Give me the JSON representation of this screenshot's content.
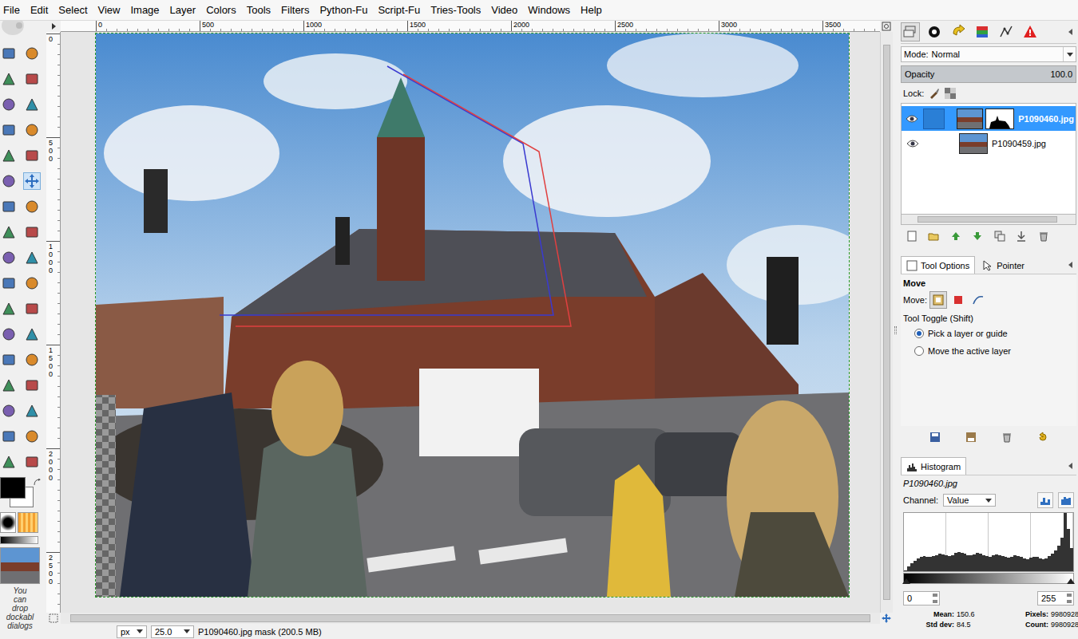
{
  "window": {
    "title": "GIMP"
  },
  "menu": [
    "File",
    "Edit",
    "Select",
    "View",
    "Image",
    "Layer",
    "Colors",
    "Tools",
    "Filters",
    "Python-Fu",
    "Script-Fu",
    "Tries-Tools",
    "Video",
    "Windows",
    "Help"
  ],
  "toolbox": {
    "tools": [
      {
        "selected": false
      },
      {
        "selected": false
      },
      {
        "selected": false
      },
      {
        "selected": false
      },
      {
        "selected": false
      },
      {
        "selected": false
      },
      {
        "selected": false
      },
      {
        "selected": false
      },
      {
        "selected": false
      },
      {
        "selected": false
      },
      {
        "selected": false
      },
      {
        "selected": true
      },
      {
        "selected": false
      },
      {
        "selected": false
      },
      {
        "selected": false
      },
      {
        "selected": false
      },
      {
        "selected": false
      },
      {
        "selected": false
      },
      {
        "selected": false
      },
      {
        "selected": false
      },
      {
        "selected": false
      },
      {
        "selected": false
      },
      {
        "selected": false
      },
      {
        "selected": false
      },
      {
        "selected": false
      },
      {
        "selected": false
      },
      {
        "selected": false
      },
      {
        "selected": false
      },
      {
        "selected": false
      },
      {
        "selected": false
      },
      {
        "selected": false
      },
      {
        "selected": false
      },
      {
        "selected": false
      },
      {
        "selected": false
      }
    ],
    "hint": [
      "You",
      "can",
      "drop",
      "dockabl",
      "dialogs"
    ]
  },
  "canvas": {
    "ruler_top": [
      "0",
      "500",
      "1000",
      "1500",
      "2000",
      "2500",
      "3000",
      "3500"
    ],
    "ruler_left": [
      "0",
      "500",
      "1000",
      "1500",
      "2000",
      "2500"
    ]
  },
  "status_bar": {
    "unit": "px",
    "zoom": "25.0",
    "message": "P1090460.jpg mask (200.5 MB)"
  },
  "layers_dock": {
    "tabs": [
      {
        "selected": true
      },
      {
        "selected": false
      },
      {
        "selected": false
      },
      {
        "selected": false
      },
      {
        "selected": false
      },
      {
        "selected": false
      }
    ],
    "mode_label": "Mode:",
    "mode": "Normal",
    "opacity_label": "Opacity",
    "opacity": "100.0",
    "opacity_level": 1.0,
    "lock_label": "Lock:",
    "layers": [
      {
        "name": "P1090460.jpg",
        "selected": true,
        "visible": true,
        "has_mask": true
      },
      {
        "name": "P1090459.jpg",
        "selected": false,
        "visible": true,
        "has_mask": false
      }
    ]
  },
  "tool_options": {
    "tabs": [
      {
        "label": "Tool Options",
        "selected": true
      },
      {
        "label": "Pointer",
        "selected": false
      }
    ],
    "title": "Move",
    "move_label": "Move:",
    "move_modes": [
      {
        "selected": true
      },
      {
        "selected": false
      },
      {
        "selected": false
      }
    ],
    "toggle_label": "Tool Toggle (Shift)",
    "options": [
      {
        "label": "Pick a layer or guide",
        "selected": true
      },
      {
        "label": "Move the active layer",
        "selected": false
      }
    ]
  },
  "histogram": {
    "title": "Histogram",
    "layer": "P1090460.jpg",
    "channel_label": "Channel:",
    "channel": "Value",
    "range_min": "0",
    "range_max": "255",
    "values": [
      2,
      8,
      14,
      18,
      22,
      24,
      26,
      25,
      24,
      26,
      28,
      30,
      29,
      27,
      26,
      28,
      31,
      33,
      32,
      30,
      28,
      27,
      29,
      31,
      30,
      28,
      26,
      25,
      27,
      29,
      28,
      26,
      24,
      23,
      25,
      27,
      26,
      24,
      22,
      21,
      23,
      25,
      24,
      22,
      20,
      22,
      26,
      30,
      36,
      44,
      58,
      100,
      72,
      40
    ],
    "stats": [
      {
        "label": "Mean:",
        "value": "150.6"
      },
      {
        "label": "Pixels:",
        "value": "9980928"
      },
      {
        "label": "Std dev:",
        "value": "84.5"
      },
      {
        "label": "Count:",
        "value": "9980928"
      }
    ]
  }
}
